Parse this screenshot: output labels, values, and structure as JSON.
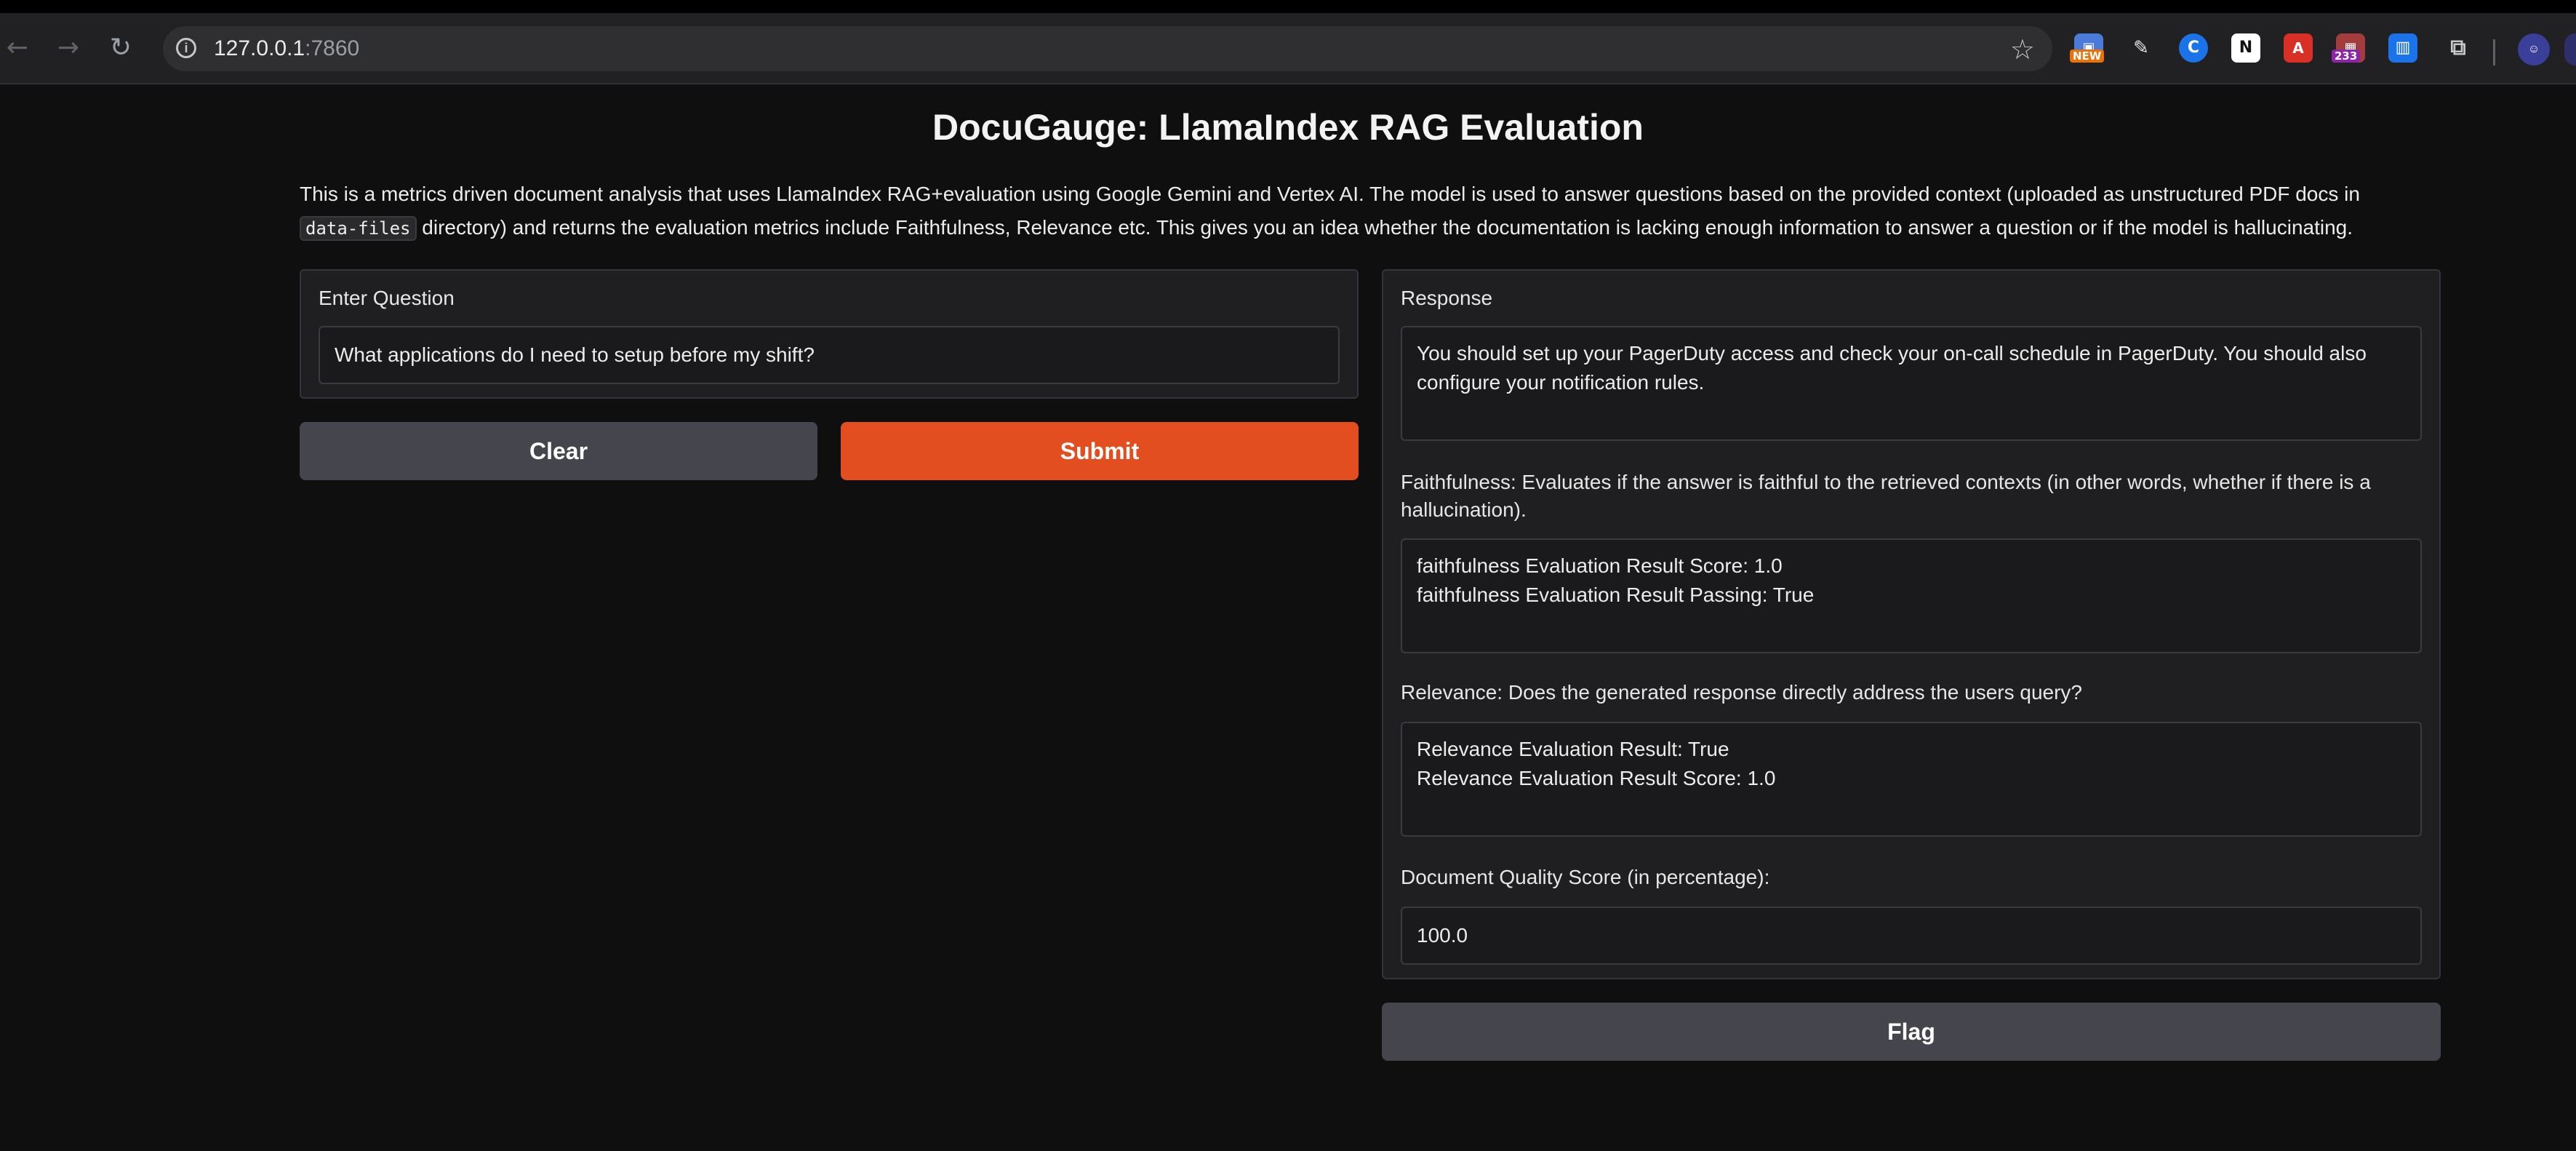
{
  "browser": {
    "url_host": "127.0.0.1",
    "url_port": ":7860",
    "nav_icons": [
      "back-arrow-icon",
      "forward-arrow-icon",
      "reload-icon"
    ],
    "extensions": [
      {
        "name": "new-extension-icon",
        "badge": "NEW",
        "color": "#4a7bd9",
        "badge_color": "#e8710a"
      },
      {
        "name": "cleaner-extension-icon",
        "color": "#2a2a2d"
      },
      {
        "name": "cookie-extension-icon",
        "color": "#1a73e8"
      },
      {
        "name": "notion-extension-icon",
        "color": "#ffffff"
      },
      {
        "name": "pdf-extension-icon",
        "color": "#d93025"
      },
      {
        "name": "counter-extension-icon",
        "badge": "233",
        "color": "#8e24aa",
        "badge_color": "#8e24aa"
      },
      {
        "name": "analytics-extension-icon",
        "color": "#1a73e8"
      },
      {
        "name": "puzzle-extensions-icon",
        "color": "#c4c7c5"
      }
    ]
  },
  "app": {
    "title": "DocuGauge: LlamaIndex RAG Evaluation",
    "description": {
      "part1": "This is a metrics driven document analysis that uses LlamaIndex RAG+evaluation using Google Gemini and Vertex AI. The model is used to answer questions based on the provided context (uploaded as unstructured PDF docs in ",
      "code": "data-files",
      "part2": " directory) and returns the evaluation metrics include Faithfulness, Relevance etc. This gives you an idea whether the documentation is lacking enough information to answer a question or if the model is hallucinating."
    },
    "question": {
      "label": "Enter Question",
      "value": "What applications do I need to setup before my shift?"
    },
    "buttons": {
      "clear": "Clear",
      "submit": "Submit",
      "flag": "Flag"
    },
    "response": {
      "label": "Response",
      "value": "You should set up your PagerDuty access and check your on-call schedule in PagerDuty. You should also configure your notification rules."
    },
    "faithfulness": {
      "label": "Faithfulness: Evaluates if the answer is faithful to the retrieved contexts (in other words, whether if there is a hallucination).",
      "line1": "faithfulness Evaluation Result Score: 1.0",
      "line2": "faithfulness Evaluation Result Passing: True"
    },
    "relevance": {
      "label": "Relevance: Does the generated response directly address the users query?",
      "line1": "Relevance Evaluation Result: True",
      "line2": "Relevance Evaluation Result Score: 1.0"
    },
    "quality": {
      "label": "Document Quality Score (in percentage):",
      "value": "100.0"
    }
  },
  "colors": {
    "background": "#0f0f10",
    "panel": "#1f1f22",
    "submit": "#e24e1f",
    "secondary_button": "#45454d"
  }
}
